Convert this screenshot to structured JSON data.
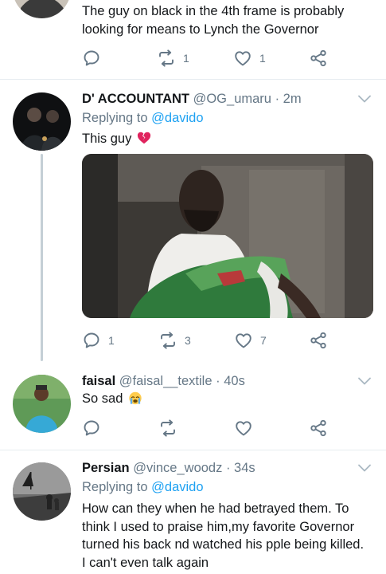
{
  "tweets": [
    {
      "text_lines": [
        "The guy on black in the 4th frame is probably",
        "looking for means to Lynch the Governor"
      ],
      "actions": {
        "reply": "",
        "retweet": "1",
        "like": "1"
      }
    },
    {
      "name": "D' ACCOUNTANT",
      "handle": "@OG_umaru",
      "separator": "·",
      "time": "2m",
      "replying_label": "Replying to",
      "replying_to": "@davido",
      "text": "This guy",
      "emoji": "broken-heart",
      "actions": {
        "reply": "1",
        "retweet": "3",
        "like": "7"
      }
    },
    {
      "name": "faisal",
      "handle": "@faisal__textile",
      "separator": "·",
      "time": "40s",
      "text": "So sad",
      "emoji": "crying-face",
      "actions": {
        "reply": "",
        "retweet": "",
        "like": ""
      }
    },
    {
      "name": "Persian",
      "handle": "@vince_woodz",
      "separator": "·",
      "time": "34s",
      "replying_label": "Replying to",
      "replying_to": "@davido",
      "text_lines": [
        "How can they when he had betrayed them. To",
        "think I used to praise him,my favorite Governor",
        "turned his back nd watched his pple being killed.",
        "I can't even talk again"
      ]
    }
  ],
  "colors": {
    "accent": "#1da1f2",
    "secondary_text": "#657786",
    "icon": "#657786",
    "divider": "#e6ecf0",
    "thread_line": "#c4cfd6"
  },
  "icons": [
    "reply-icon",
    "retweet-icon",
    "like-icon",
    "share-icon",
    "caret-down-icon"
  ]
}
